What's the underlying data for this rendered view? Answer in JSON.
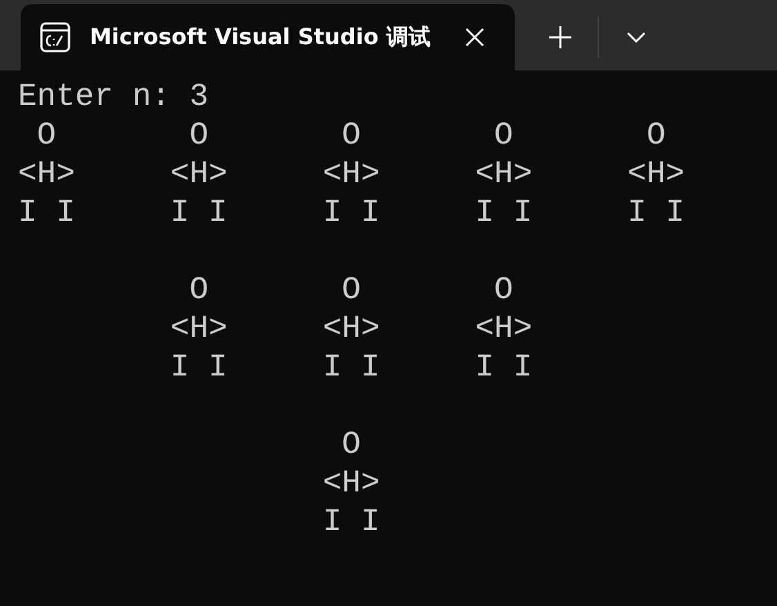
{
  "tab": {
    "title": "Microsoft Visual Studio 调试",
    "selected": true
  },
  "terminal": {
    "prompt": "Enter n: 3",
    "blocks": [
      [
        " O       O       O       O       O",
        "<H>     <H>     <H>     <H>     <H>",
        "I I     I I     I I     I I     I I"
      ],
      [
        "         O       O       O",
        "        <H>     <H>     <H>",
        "        I I     I I     I I"
      ],
      [
        "                 O",
        "                <H>",
        "                I I"
      ]
    ]
  }
}
